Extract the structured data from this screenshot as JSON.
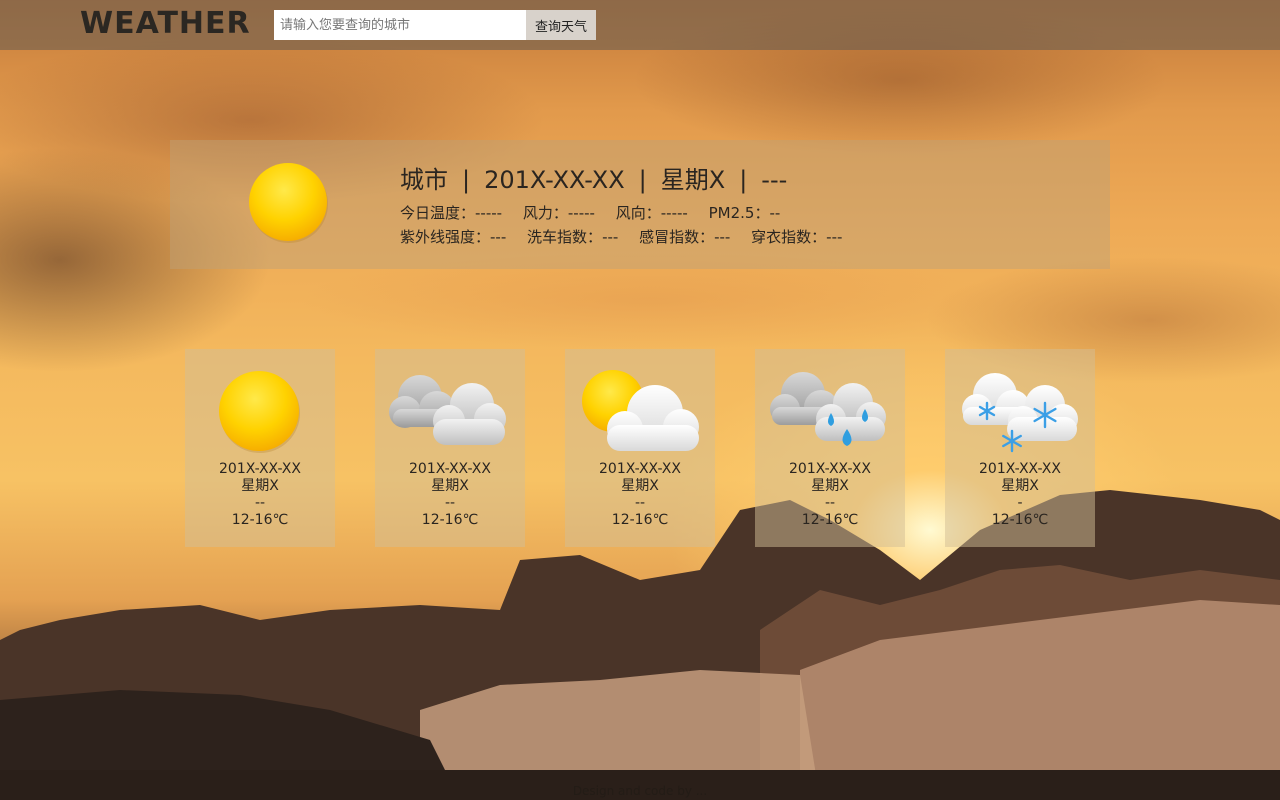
{
  "header": {
    "brand": "WEATHER",
    "search_placeholder": "请输入您要查询的城市",
    "search_button": "查询天气"
  },
  "today": {
    "icon": "sunny-icon",
    "city": "城市",
    "date": "201X-XX-XX",
    "weekday": "星期X",
    "condition": "---",
    "separator": "|",
    "details_row1": [
      {
        "label": "今日温度：",
        "value": "-----"
      },
      {
        "label": "风力：",
        "value": "-----"
      },
      {
        "label": "风向：",
        "value": "-----"
      },
      {
        "label": "PM2.5：",
        "value": "--"
      }
    ],
    "details_row2": [
      {
        "label": "紫外线强度：",
        "value": "---"
      },
      {
        "label": "洗车指数：",
        "value": "---"
      },
      {
        "label": "感冒指数：",
        "value": "---"
      },
      {
        "label": "穿衣指数：",
        "value": "---"
      }
    ]
  },
  "forecast": [
    {
      "icon": "sunny-icon",
      "date": "201X-XX-XX",
      "weekday": "星期X",
      "condition": "--",
      "temp": "12-16℃"
    },
    {
      "icon": "cloudy-icon",
      "date": "201X-XX-XX",
      "weekday": "星期X",
      "condition": "--",
      "temp": "12-16℃"
    },
    {
      "icon": "partly-cloudy-icon",
      "date": "201X-XX-XX",
      "weekday": "星期X",
      "condition": "--",
      "temp": "12-16℃"
    },
    {
      "icon": "rain-icon",
      "date": "201X-XX-XX",
      "weekday": "星期X",
      "condition": "--",
      "temp": "12-16℃"
    },
    {
      "icon": "snow-icon",
      "date": "201X-XX-XX",
      "weekday": "星期X",
      "condition": "-",
      "temp": "12-16℃"
    }
  ],
  "footer": {
    "text": "Design and code by ..."
  }
}
